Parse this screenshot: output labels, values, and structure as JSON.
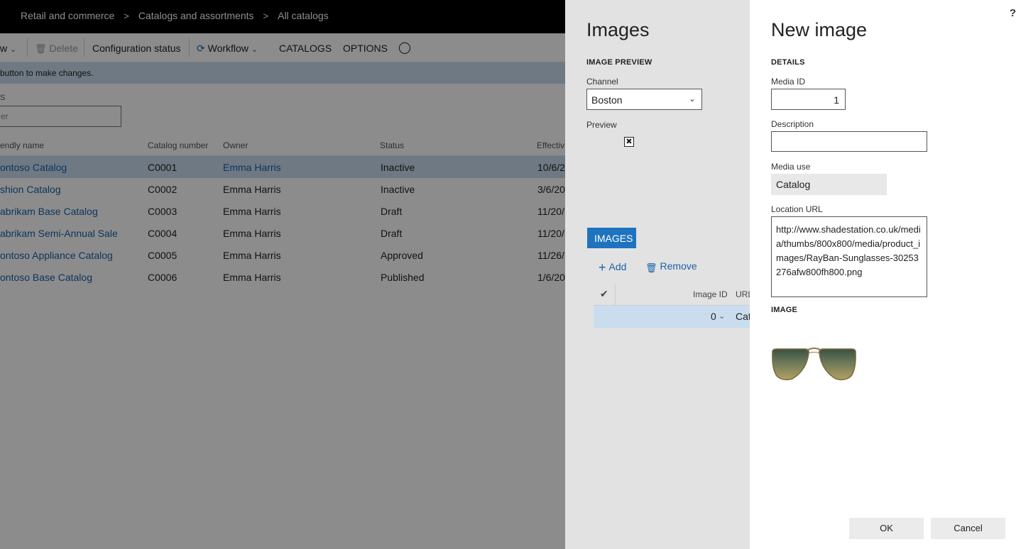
{
  "breadcrumb": [
    "Retail and commerce",
    "Catalogs and assortments",
    "All catalogs"
  ],
  "breadcrumb_separator": ">",
  "actionbar": {
    "new_label": "w",
    "delete_label": "Delete",
    "config_status_label": "Configuration status",
    "workflow_label": "Workflow",
    "catalogs_tab": "CATALOGS",
    "options_tab": "OPTIONS"
  },
  "info_message": "button to make changes.",
  "section_label": "S",
  "filter_placeholder": "er",
  "table": {
    "headers": [
      "endly name",
      "Catalog number",
      "Owner",
      "Status",
      "Effectiv"
    ],
    "rows": [
      {
        "name": "ontoso Catalog",
        "number": "C0001",
        "owner": "Emma Harris",
        "status": "Inactive",
        "effective": "10/6/2"
      },
      {
        "name": "shion Catalog",
        "number": "C0002",
        "owner": "Emma Harris",
        "status": "Inactive",
        "effective": "3/6/20"
      },
      {
        "name": "abrikam Base Catalog",
        "number": "C0003",
        "owner": "Emma Harris",
        "status": "Draft",
        "effective": "11/20/"
      },
      {
        "name": "abrikam Semi-Annual Sale",
        "number": "C0004",
        "owner": "Emma Harris",
        "status": "Draft",
        "effective": "11/20/"
      },
      {
        "name": "ontoso Appliance Catalog",
        "number": "C0005",
        "owner": "Emma Harris",
        "status": "Approved",
        "effective": "11/26/"
      },
      {
        "name": "ontoso Base Catalog",
        "number": "C0006",
        "owner": "Emma Harris",
        "status": "Published",
        "effective": "1/6/20"
      }
    ]
  },
  "images_panel": {
    "title": "Images",
    "preview_section": "IMAGE PREVIEW",
    "channel_label": "Channel",
    "channel_value": "Boston",
    "preview_label": "Preview",
    "images_tab": "IMAGES",
    "add_label": "Add",
    "remove_label": "Remove",
    "grid_headers": {
      "image_id": "Image ID",
      "url": "URL"
    },
    "grid_row": {
      "image_id": "0",
      "url": "Cat"
    }
  },
  "new_image_panel": {
    "title": "New image",
    "help": "?",
    "details_section": "DETAILS",
    "media_id_label": "Media ID",
    "media_id_value": "1",
    "description_label": "Description",
    "description_value": "",
    "media_use_label": "Media use",
    "media_use_value": "Catalog",
    "location_url_label": "Location URL",
    "location_url_value": "http://www.shadestation.co.uk/media/thumbs/800x800/media/product_images/RayBan-Sunglasses-30253276afw800fh800.png",
    "image_section": "IMAGE",
    "ok_label": "OK",
    "cancel_label": "Cancel"
  },
  "colors": {
    "navbar": "#000000",
    "accent": "#1e73be",
    "link": "#1a62a8",
    "selected_row": "#c9ddef",
    "panel_bg": "#e2e2e2"
  },
  "icons": [
    "chevron-right-icon",
    "trash-icon",
    "workflow-icon",
    "lightbulb-icon",
    "chevron-down-icon",
    "broken-image-icon",
    "plus-icon",
    "checkmark-icon",
    "help-icon",
    "sunglasses-image"
  ]
}
